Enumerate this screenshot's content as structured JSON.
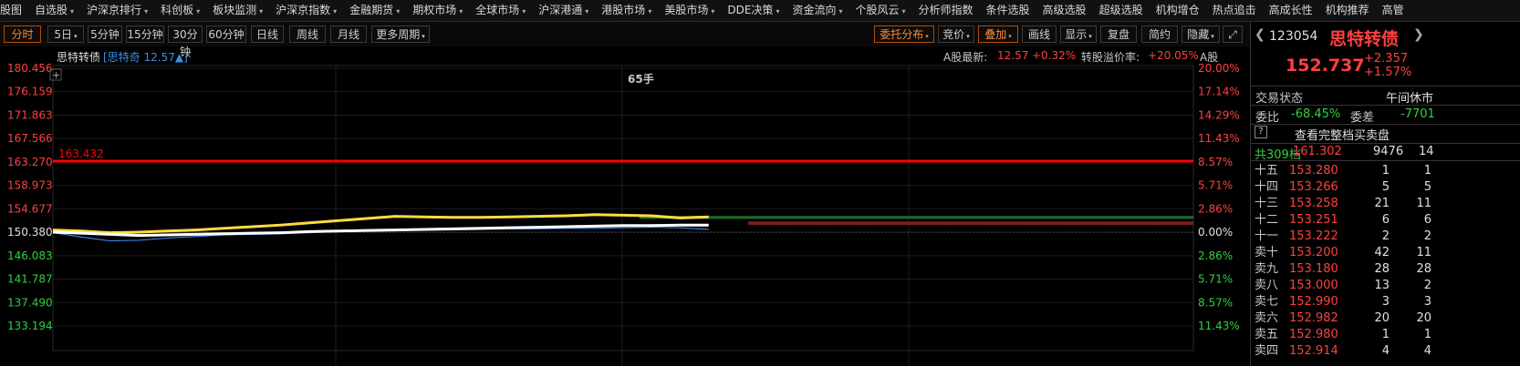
{
  "topnav": {
    "items": [
      {
        "label": "股图",
        "arrow": false
      },
      {
        "label": "自选股",
        "arrow": true
      },
      {
        "label": "沪深京排行",
        "arrow": true
      },
      {
        "label": "科创板",
        "arrow": true
      },
      {
        "label": "板块监测",
        "arrow": true
      },
      {
        "label": "沪深京指数",
        "arrow": true
      },
      {
        "label": "金融期货",
        "arrow": true
      },
      {
        "label": "期权市场",
        "arrow": true
      },
      {
        "label": "全球市场",
        "arrow": true
      },
      {
        "label": "沪深港通",
        "arrow": true
      },
      {
        "label": "港股市场",
        "arrow": true
      },
      {
        "label": "美股市场",
        "arrow": true
      },
      {
        "label": "DDE决策",
        "arrow": true
      },
      {
        "label": "资金流向",
        "arrow": true
      },
      {
        "label": "个股风云",
        "arrow": true
      },
      {
        "label": "分析师指数",
        "arrow": false
      },
      {
        "label": "条件选股",
        "arrow": false
      },
      {
        "label": "高级选股",
        "arrow": false
      },
      {
        "label": "超级选股",
        "arrow": false
      },
      {
        "label": "机构增仓",
        "arrow": false
      },
      {
        "label": "热点追击",
        "arrow": false
      },
      {
        "label": "高成长性",
        "arrow": false
      },
      {
        "label": "机构推荐",
        "arrow": false
      },
      {
        "label": "高管",
        "arrow": false
      }
    ]
  },
  "toolbar": {
    "periods": [
      {
        "label": "分时",
        "arrow": false,
        "active": true
      },
      {
        "label": "5日",
        "arrow": true,
        "active": false
      },
      {
        "label": "5分钟",
        "arrow": false,
        "active": false
      },
      {
        "label": "15分钟",
        "arrow": false,
        "active": false
      },
      {
        "label": "30分钟",
        "arrow": false,
        "active": false
      },
      {
        "label": "60分钟",
        "arrow": false,
        "active": false
      },
      {
        "label": "日线",
        "arrow": false,
        "active": false
      },
      {
        "label": "周线",
        "arrow": false,
        "active": false
      },
      {
        "label": "月线",
        "arrow": false,
        "active": false
      },
      {
        "label": "更多周期",
        "arrow": true,
        "active": false
      }
    ],
    "tools": [
      {
        "label": "委托分布",
        "arrow": true,
        "active": true
      },
      {
        "label": "竞价",
        "arrow": true,
        "active": false
      },
      {
        "label": "叠加",
        "arrow": true,
        "active": true
      },
      {
        "label": "画线",
        "arrow": false,
        "active": false
      },
      {
        "label": "显示",
        "arrow": true,
        "active": false
      },
      {
        "label": "复盘",
        "arrow": false,
        "active": false
      },
      {
        "label": "简约",
        "arrow": false,
        "active": false
      },
      {
        "label": "隐藏",
        "arrow": true,
        "active": false
      }
    ],
    "expand_icon": "expand-icon"
  },
  "infobar": {
    "name": "思特转债",
    "overlay": "[思特奇 12.57▲]",
    "close_glyph": "×",
    "stock_latest_label": "A股最新:",
    "stock_latest_value": "12.57",
    "stock_change": "+0.32%",
    "premium_label": "转股溢价率:",
    "premium_value": "+20.05%",
    "stock_tag": "A股",
    "plus_glyph": "+"
  },
  "colors": {
    "up": "#ff4040",
    "down": "#30d040",
    "price_line": "#ffffff",
    "avg_line": "#ffdc40",
    "overlay_line": "#3a7fd8",
    "limit_line": "#ff0000",
    "accent": "#ff8a3c"
  },
  "chart_data": {
    "type": "line",
    "title": "",
    "annotation": "65手",
    "reference_line_label": "163.432",
    "reference_line_value": 163.432,
    "prev_close": 150.38,
    "ylim": [
      133.194,
      180.456
    ],
    "y_ticks_left": [
      {
        "value": 180.456,
        "label": "180.456",
        "dir": "up"
      },
      {
        "value": 176.159,
        "label": "176.159",
        "dir": "up"
      },
      {
        "value": 171.863,
        "label": "171.863",
        "dir": "up"
      },
      {
        "value": 167.566,
        "label": "167.566",
        "dir": "up"
      },
      {
        "value": 163.27,
        "label": "163.270",
        "dir": "up"
      },
      {
        "value": 158.973,
        "label": "158.973",
        "dir": "up"
      },
      {
        "value": 154.677,
        "label": "154.677",
        "dir": "up"
      },
      {
        "value": 150.38,
        "label": "150.380",
        "dir": "flat"
      },
      {
        "value": 146.083,
        "label": "146.083",
        "dir": "down"
      },
      {
        "value": 141.787,
        "label": "141.787",
        "dir": "down"
      },
      {
        "value": 137.49,
        "label": "137.490",
        "dir": "down"
      },
      {
        "value": 133.194,
        "label": "133.194",
        "dir": "down"
      }
    ],
    "y_ticks_right": [
      {
        "label": "20.00%",
        "dir": "up"
      },
      {
        "label": "17.14%",
        "dir": "up"
      },
      {
        "label": "14.29%",
        "dir": "up"
      },
      {
        "label": "11.43%",
        "dir": "up"
      },
      {
        "label": "8.57%",
        "dir": "up"
      },
      {
        "label": "5.71%",
        "dir": "up"
      },
      {
        "label": "2.86%",
        "dir": "up"
      },
      {
        "label": "0.00%",
        "dir": "flat"
      },
      {
        "label": "2.86%",
        "dir": "down"
      },
      {
        "label": "5.71%",
        "dir": "down"
      },
      {
        "label": "8.57%",
        "dir": "down"
      },
      {
        "label": "11.43%",
        "dir": "down"
      }
    ],
    "x": [
      0,
      6,
      12,
      18,
      24,
      30,
      36,
      42,
      48,
      54,
      60,
      66,
      72,
      78,
      84,
      90,
      96,
      102,
      108,
      114,
      120,
      126,
      132,
      138
    ],
    "x_max": 240,
    "series": [
      {
        "key": "price",
        "values": [
          150.4,
          150.2,
          150.0,
          149.8,
          149.9,
          150.0,
          150.1,
          150.2,
          150.3,
          150.5,
          150.6,
          150.7,
          150.8,
          150.9,
          151.0,
          151.1,
          151.2,
          151.3,
          151.4,
          151.5,
          151.6,
          151.6,
          151.7,
          151.7
        ]
      },
      {
        "key": "avg",
        "values": [
          150.8,
          150.6,
          150.3,
          150.4,
          150.6,
          150.8,
          151.1,
          151.4,
          151.7,
          152.1,
          152.5,
          152.9,
          153.3,
          153.2,
          153.1,
          153.1,
          153.2,
          153.3,
          153.4,
          153.6,
          153.5,
          153.4,
          153.0,
          153.2
        ]
      },
      {
        "key": "overlay",
        "values": [
          150.3,
          149.5,
          148.8,
          148.9,
          149.3,
          149.6,
          149.9,
          150.0,
          150.1,
          150.3,
          150.5,
          150.6,
          150.7,
          150.8,
          150.8,
          150.9,
          151.0,
          151.0,
          151.1,
          151.1,
          151.2,
          151.3,
          151.2,
          150.9
        ]
      }
    ],
    "order_depth": [
      {
        "side": "sell",
        "value": 153.2,
        "length": 0.97
      },
      {
        "side": "sell",
        "value": 153.0,
        "length": 0.97
      },
      {
        "side": "buy",
        "value": 152.2,
        "length": 0.78
      },
      {
        "side": "buy",
        "value": 151.9,
        "length": 0.78
      }
    ]
  },
  "right_panel": {
    "code": "123054",
    "name": "思特转债",
    "price": "152.737",
    "change": "+2.357",
    "change_pct": "+1.57%",
    "status_label": "交易状态",
    "status_value": "午间休市",
    "weibi_label": "委比",
    "weibi_value": "-68.45%",
    "weicha_label": "委差",
    "weicha_value": "-7701",
    "help_glyph": "?",
    "view_full_label": "查看完整档买卖盘",
    "total_label": "共309档",
    "total_price": "161.302",
    "total_volume": "9476",
    "total_extra": "14",
    "levels": [
      {
        "label": "十五",
        "price": "153.280",
        "vol": "1",
        "extra": "1"
      },
      {
        "label": "十四",
        "price": "153.266",
        "vol": "5",
        "extra": "5"
      },
      {
        "label": "十三",
        "price": "153.258",
        "vol": "21",
        "extra": "11"
      },
      {
        "label": "十二",
        "price": "153.251",
        "vol": "6",
        "extra": "6"
      },
      {
        "label": "十一",
        "price": "153.222",
        "vol": "2",
        "extra": "2"
      },
      {
        "label": "卖十",
        "price": "153.200",
        "vol": "42",
        "extra": "11"
      },
      {
        "label": "卖九",
        "price": "153.180",
        "vol": "28",
        "extra": "28"
      },
      {
        "label": "卖八",
        "price": "153.000",
        "vol": "13",
        "extra": "2"
      },
      {
        "label": "卖七",
        "price": "152.990",
        "vol": "3",
        "extra": "3"
      },
      {
        "label": "卖六",
        "price": "152.982",
        "vol": "20",
        "extra": "20"
      },
      {
        "label": "卖五",
        "price": "152.980",
        "vol": "1",
        "extra": "1"
      },
      {
        "label": "卖四",
        "price": "152.914",
        "vol": "4",
        "extra": "4"
      }
    ]
  }
}
